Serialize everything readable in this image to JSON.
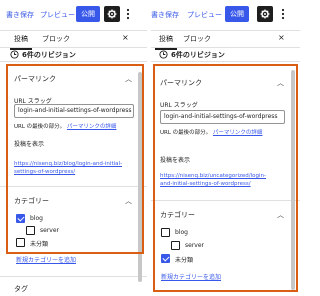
{
  "left": {
    "toolbar": {
      "draft": "書き保存",
      "preview": "プレビュー",
      "publish": "公開"
    },
    "tabs": {
      "post": "投稿",
      "block": "ブロック",
      "close": "×"
    },
    "revisions": "6件のリビジョン",
    "permalink": {
      "title": "パーマリンク",
      "slug_label": "URL スラッグ",
      "slug_value": "login-and-initial-settings-of-wordpress",
      "help_prefix": "URL の最後の部分。",
      "help_link": "パーマリンクの詳細",
      "view_label": "投稿を表示",
      "url_line1": "https://nisenq.biz/blog/login-and-initial-",
      "url_line2": "settings-of-wordpress/"
    },
    "category": {
      "title": "カテゴリー",
      "items": [
        {
          "label": "blog",
          "checked": true
        },
        {
          "label": "server",
          "checked": false
        },
        {
          "label": "未分類",
          "checked": false
        }
      ],
      "add_link": "新規カテゴリーを追加"
    },
    "tags_title": "タグ"
  },
  "right": {
    "toolbar": {
      "draft": "書き保存",
      "preview": "プレビュー",
      "publish": "公開"
    },
    "tabs": {
      "post": "投稿",
      "block": "ブロック",
      "close": "×"
    },
    "revisions": "6件のリビジョン",
    "permalink": {
      "title": "パーマリンク",
      "slug_label": "URL スラッグ",
      "slug_value": "login-and-initial-settings-of-wordpress",
      "help_prefix": "URL の最後の部分。",
      "help_link": "パーマリンクの詳細",
      "view_label": "投稿を表示",
      "url_line1": "https://nisenq.biz/uncategorized/login-",
      "url_line2": "and-initial-settings-of-wordpress/"
    },
    "category": {
      "title": "カテゴリー",
      "items": [
        {
          "label": "blog",
          "checked": false
        },
        {
          "label": "server",
          "checked": false
        },
        {
          "label": "未分類",
          "checked": true
        }
      ],
      "add_link": "新規カテゴリーを追加"
    }
  },
  "colors": {
    "accent": "#3858e9",
    "highlight": "#d95e14",
    "text": "#1e1e1e",
    "border": "#e0e0e0"
  }
}
